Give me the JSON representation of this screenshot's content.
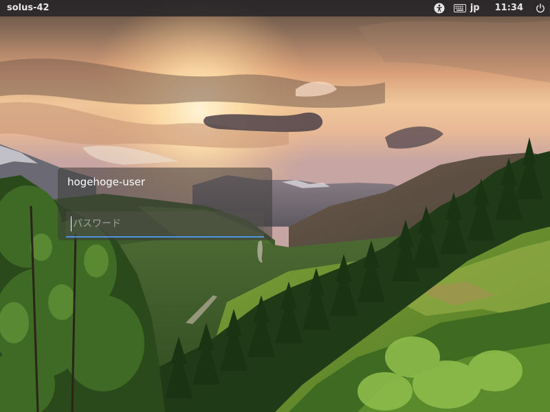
{
  "top_panel": {
    "hostname": "solus-42",
    "accessibility_icon": "accessibility-icon",
    "keyboard_icon": "keyboard-icon",
    "input_language": "jp",
    "clock": "11:34",
    "power_icon": "power-icon"
  },
  "login": {
    "username": "hogehoge-user",
    "password_placeholder": "パスワード",
    "password_value": ""
  },
  "colors": {
    "panel_bg": "#262428",
    "input_accent": "#4f94e0",
    "text": "#ffffff"
  }
}
